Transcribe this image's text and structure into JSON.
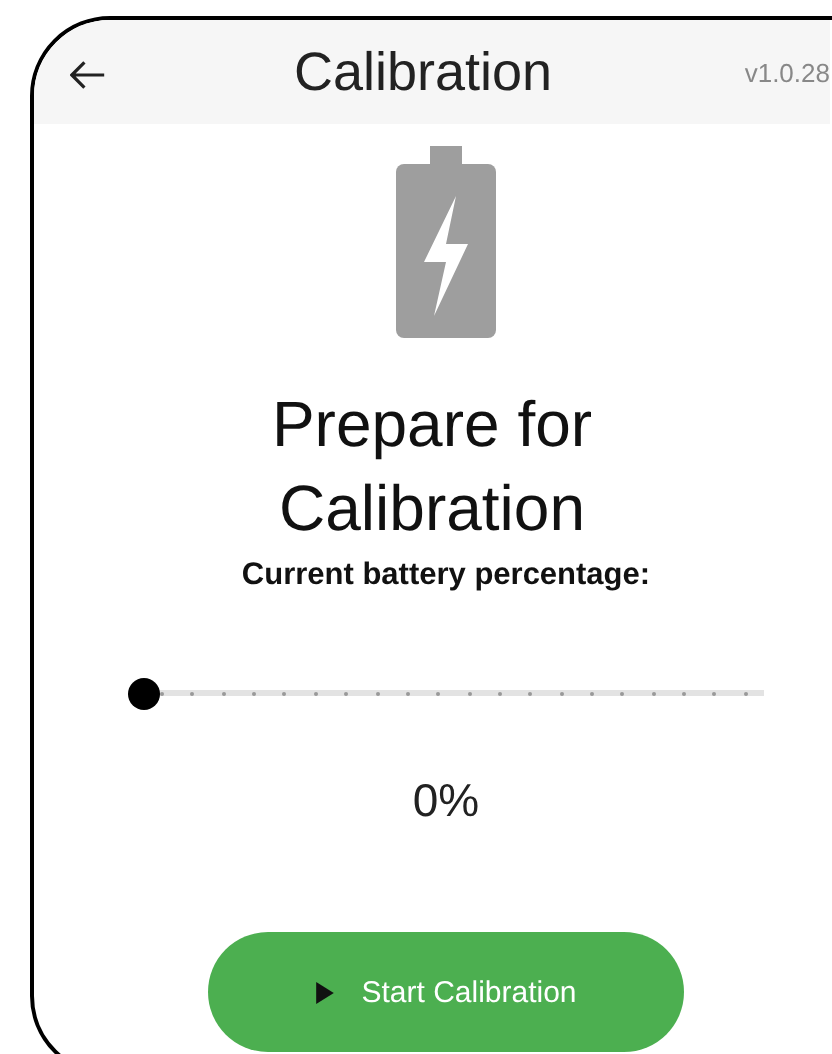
{
  "header": {
    "title": "Calibration",
    "version": "v1.0.28"
  },
  "heading": "Prepare for Calibration",
  "subtitle": "Current battery percentage:",
  "slider": {
    "level": 0
  },
  "reading": "0%",
  "button": {
    "label": "Start Calibration"
  }
}
